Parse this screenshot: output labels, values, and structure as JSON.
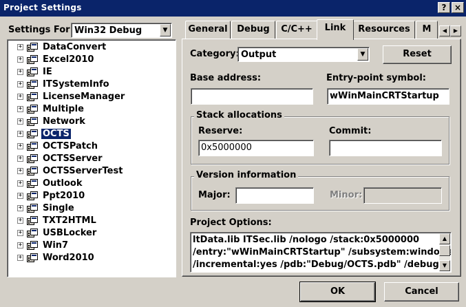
{
  "window": {
    "title": "Project Settings",
    "help_label": "?",
    "close_label": "×"
  },
  "left": {
    "settings_for_label": "Settings For:",
    "settings_for_value": "Win32 Debug",
    "tree_items": [
      {
        "label": "DataConvert",
        "selected": false
      },
      {
        "label": "Excel2010",
        "selected": false
      },
      {
        "label": "IE",
        "selected": false
      },
      {
        "label": "ITSystemInfo",
        "selected": false
      },
      {
        "label": "LicenseManager",
        "selected": false
      },
      {
        "label": "Multiple",
        "selected": false
      },
      {
        "label": "Network",
        "selected": false
      },
      {
        "label": "OCTS",
        "selected": true
      },
      {
        "label": "OCTSPatch",
        "selected": false
      },
      {
        "label": "OCTSServer",
        "selected": false
      },
      {
        "label": "OCTSServerTest",
        "selected": false
      },
      {
        "label": "Outlook",
        "selected": false
      },
      {
        "label": "Ppt2010",
        "selected": false
      },
      {
        "label": "Single",
        "selected": false
      },
      {
        "label": "TXT2HTML",
        "selected": false
      },
      {
        "label": "USBLocker",
        "selected": false
      },
      {
        "label": "Win7",
        "selected": false
      },
      {
        "label": "Word2010",
        "selected": false
      }
    ],
    "expander_symbol": "+"
  },
  "tabs": [
    {
      "label": "General",
      "active": false
    },
    {
      "label": "Debug",
      "active": false
    },
    {
      "label": "C/C++",
      "active": false
    },
    {
      "label": "Link",
      "active": true
    },
    {
      "label": "Resources",
      "active": false
    },
    {
      "label": "M",
      "active": false
    }
  ],
  "tab_scroll": {
    "left": "◀",
    "right": "▶"
  },
  "link": {
    "category_label": "Category:",
    "category_value": "Output",
    "reset_label": "Reset",
    "base_address_label": "Base address:",
    "base_address_value": "",
    "entry_point_label": "Entry-point symbol:",
    "entry_point_value": "wWinMainCRTStartup",
    "stack_group_label": "Stack allocations",
    "reserve_label": "Reserve:",
    "reserve_value": "0x5000000",
    "commit_label": "Commit:",
    "commit_value": "",
    "version_group_label": "Version information",
    "major_label": "Major:",
    "major_value": "",
    "minor_label": "Minor:",
    "minor_value": "",
    "project_options_label": "Project Options:",
    "project_options_lines": [
      "ltData.lib ITSec.lib /nologo /stack:0x5000000",
      "/entry:\"wWinMainCRTStartup\" /subsystem:windows",
      "/incremental:yes /pdb:\"Debug/OCTS.pdb\" /debug"
    ]
  },
  "buttons": {
    "ok": "OK",
    "cancel": "Cancel"
  },
  "colors": {
    "face": "#d4d0c8",
    "title_bar": "#0a246a",
    "selection": "#0a246a"
  }
}
